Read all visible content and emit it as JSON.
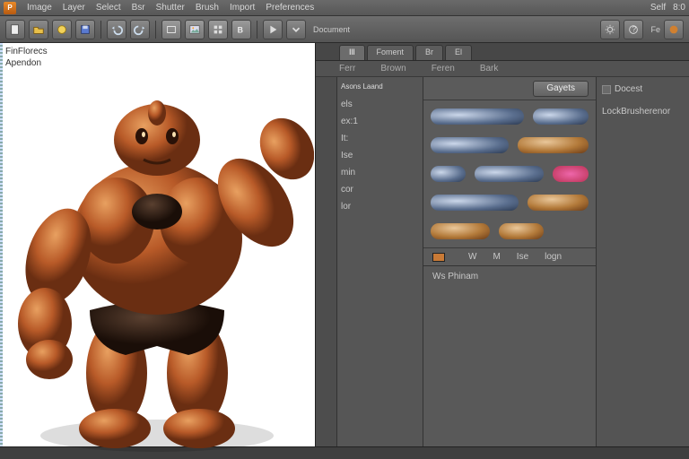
{
  "menu": {
    "items": [
      "Image",
      "Layer",
      "Select",
      "Bsr",
      "Shutter",
      "Brush",
      "Import",
      "Preferences"
    ],
    "right": [
      "Self",
      "8:0"
    ]
  },
  "toolbar": {
    "dropdown": "Document",
    "right_label": "Fe"
  },
  "canvas": {
    "hud_line1": "FinFlorecs",
    "hud_line2": "Apendon"
  },
  "tabs": {
    "items": [
      "Ill",
      "Foment",
      "Br",
      "El"
    ],
    "active": 0
  },
  "subbar": {
    "items": [
      "Ferr",
      "Brown",
      "Feren",
      "Bark"
    ]
  },
  "listcol": {
    "header": "Asons Laand",
    "items": [
      "els",
      "ex:1",
      "It:",
      "Ise",
      "min",
      "cor",
      "lor"
    ]
  },
  "brushes": {
    "button": "Gayets",
    "footer": [
      "",
      "W",
      "M",
      "Ise",
      "logn"
    ],
    "props": [
      "Docest",
      "LockBrusherenor"
    ]
  },
  "lower": {
    "title": "Ws Phinam"
  }
}
